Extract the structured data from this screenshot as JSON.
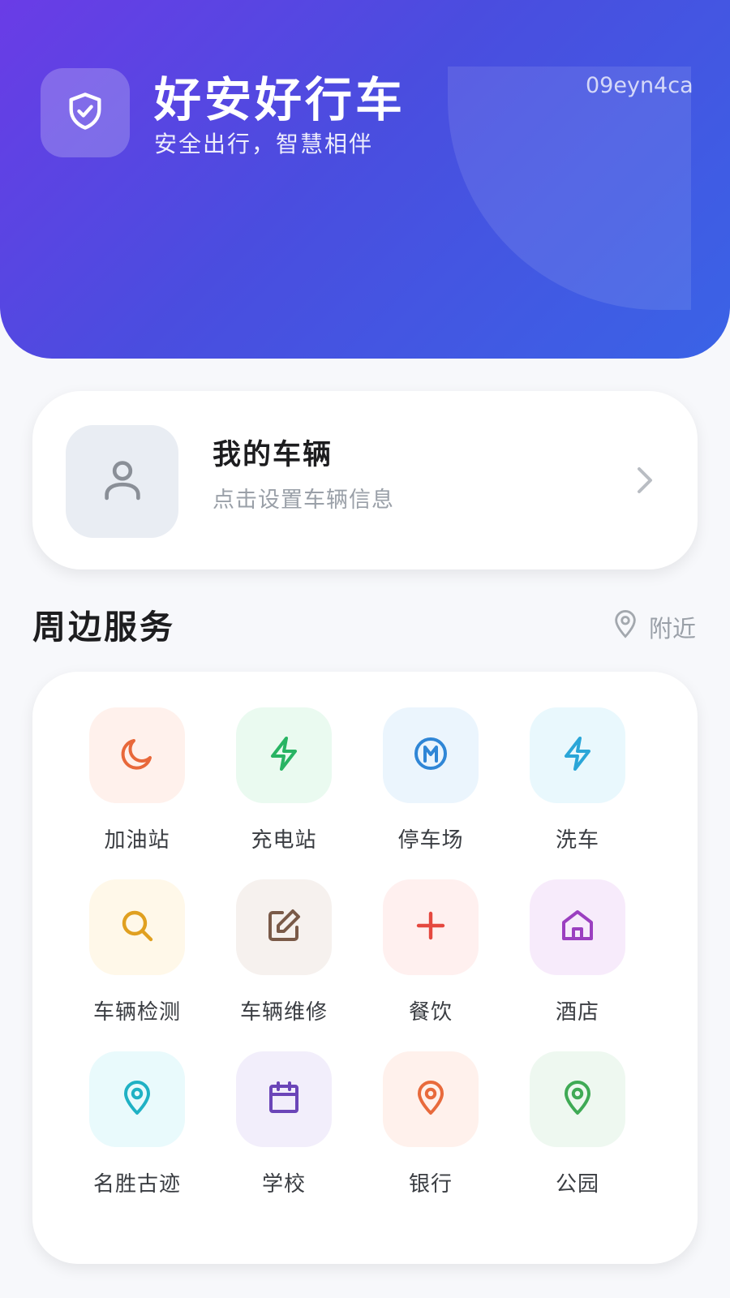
{
  "header": {
    "title": "好安好行车",
    "subtitle": "安全出行，智慧相伴",
    "watermark": "09eyn4ca",
    "logo_icon": "shield-check-icon"
  },
  "vehicle": {
    "title": "我的车辆",
    "subtitle": "点击设置车辆信息",
    "avatar_icon": "user-icon"
  },
  "services": {
    "title": "周边服务",
    "nearby_label": "附近",
    "items": [
      {
        "label": "加油站",
        "icon": "moon-icon",
        "color": "#e8683a",
        "bg": "#fff1ec"
      },
      {
        "label": "充电站",
        "icon": "bolt-icon",
        "color": "#28b463",
        "bg": "#eafaf0"
      },
      {
        "label": "停车场",
        "icon": "metro-icon",
        "color": "#2f86d6",
        "bg": "#ebf5fd"
      },
      {
        "label": "洗车",
        "icon": "bolt-icon",
        "color": "#2aa6d8",
        "bg": "#e9f8fd"
      },
      {
        "label": "车辆检测",
        "icon": "search-icon",
        "color": "#e0a020",
        "bg": "#fff8e9"
      },
      {
        "label": "车辆维修",
        "icon": "edit-icon",
        "color": "#7a5a48",
        "bg": "#f6f1ee"
      },
      {
        "label": "餐饮",
        "icon": "plus-icon",
        "color": "#e5483f",
        "bg": "#fff0ef"
      },
      {
        "label": "酒店",
        "icon": "home-icon",
        "color": "#9b3fc0",
        "bg": "#f7ebfb"
      },
      {
        "label": "名胜古迹",
        "icon": "location-icon",
        "color": "#1fb1c4",
        "bg": "#e9fafc"
      },
      {
        "label": "学校",
        "icon": "calendar-icon",
        "color": "#6b45b8",
        "bg": "#f2eefb"
      },
      {
        "label": "银行",
        "icon": "location-icon",
        "color": "#e86a3c",
        "bg": "#fff1ec"
      },
      {
        "label": "公园",
        "icon": "location-icon",
        "color": "#3faa55",
        "bg": "#eef8f0"
      }
    ]
  }
}
